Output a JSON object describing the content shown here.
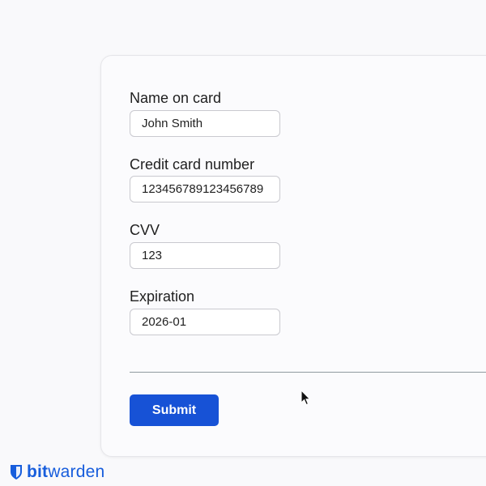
{
  "form": {
    "fields": [
      {
        "label": "Name on card",
        "value": "John Smith"
      },
      {
        "label": "Credit card number",
        "value": "123456789123456789"
      },
      {
        "label": "CVV",
        "value": "123"
      },
      {
        "label": "Expiration",
        "value": "2026-01"
      }
    ],
    "submit_label": "Submit"
  },
  "brand": {
    "name_bold": "bit",
    "name_light": "warden",
    "icon": "shield-icon",
    "color": "#175ddc"
  },
  "colors": {
    "accent": "#1752d6"
  }
}
